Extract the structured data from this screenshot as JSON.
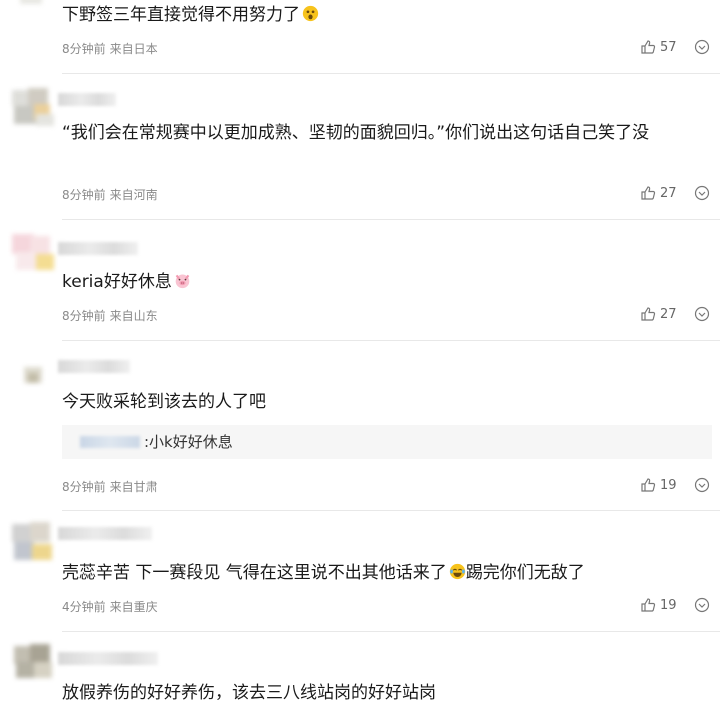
{
  "comments": [
    {
      "content": "下野签三年直接觉得不用努力了",
      "emoji": "surprised-emoji-icon",
      "time": "8分钟前",
      "location": "来自日本",
      "likes": "57"
    },
    {
      "content": "“我们会在常规赛中以更加成熟、坚韧的面貌回归。”你们说出这句话自己笑了没",
      "time": "8分钟前",
      "location": "来自河南",
      "likes": "27"
    },
    {
      "content": "keria好好休息",
      "emoji": "pig-face-emoji-icon",
      "time": "8分钟前",
      "location": "来自山东",
      "likes": "27"
    },
    {
      "content": "今天败采轮到该去的人了吧",
      "reply_quote": ":小k好好休息",
      "time": "8分钟前",
      "location": "来自甘肃",
      "likes": "19"
    },
    {
      "content_before_emoji": "壳蕊辛苦 下一赛段见 气得在这里说不出其他话来了",
      "emoji": "laughing-tears-emoji-icon",
      "content_after_emoji": "踢完你们无敌了",
      "time": "4分钟前",
      "location": "来自重庆",
      "likes": "19"
    },
    {
      "content": "放假养伤的好好养伤，该去三八线站岗的好好站岗"
    }
  ],
  "icons": {
    "like": "thumbs-up-icon",
    "more": "more-options-icon"
  },
  "colors": {
    "text": "#1a1a1a",
    "meta": "#8a8a8a",
    "divider": "#e8e8e8",
    "quote_bg": "#f6f6f6"
  }
}
